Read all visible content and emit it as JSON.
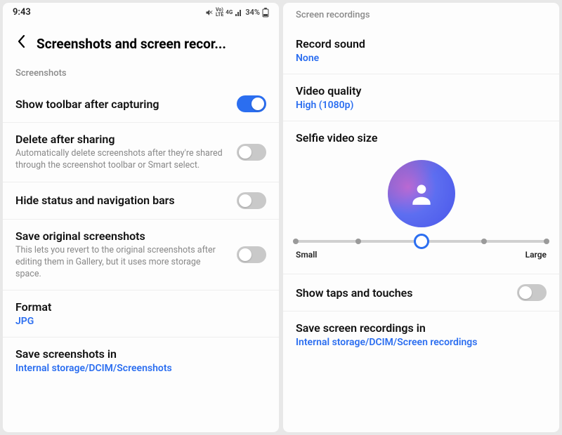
{
  "status_bar": {
    "time": "9:43",
    "battery": "34%"
  },
  "left": {
    "title": "Screenshots and screen recor...",
    "section_screenshots": "Screenshots",
    "show_toolbar": {
      "title": "Show toolbar after capturing",
      "on": true
    },
    "delete_after_sharing": {
      "title": "Delete after sharing",
      "sub": "Automatically delete screenshots after they're shared through the screenshot toolbar or Smart select.",
      "on": false
    },
    "hide_bars": {
      "title": "Hide status and navigation bars",
      "on": false
    },
    "save_original": {
      "title": "Save original screenshots",
      "sub": "This lets you revert to the original screenshots after editing them in Gallery, but it uses more storage space.",
      "on": false
    },
    "format": {
      "title": "Format",
      "value": "JPG"
    },
    "save_in": {
      "title": "Save screenshots in",
      "value": "Internal storage/DCIM/Screenshots"
    }
  },
  "right": {
    "section_recordings": "Screen recordings",
    "record_sound": {
      "title": "Record sound",
      "value": "None"
    },
    "video_quality": {
      "title": "Video quality",
      "value": "High (1080p)"
    },
    "selfie": {
      "title": "Selfie video size",
      "min_label": "Small",
      "max_label": "Large",
      "steps": 5,
      "value_index": 2
    },
    "show_taps": {
      "title": "Show taps and touches",
      "on": false
    },
    "save_in": {
      "title": "Save screen recordings in",
      "value": "Internal storage/DCIM/Screen recordings"
    }
  }
}
